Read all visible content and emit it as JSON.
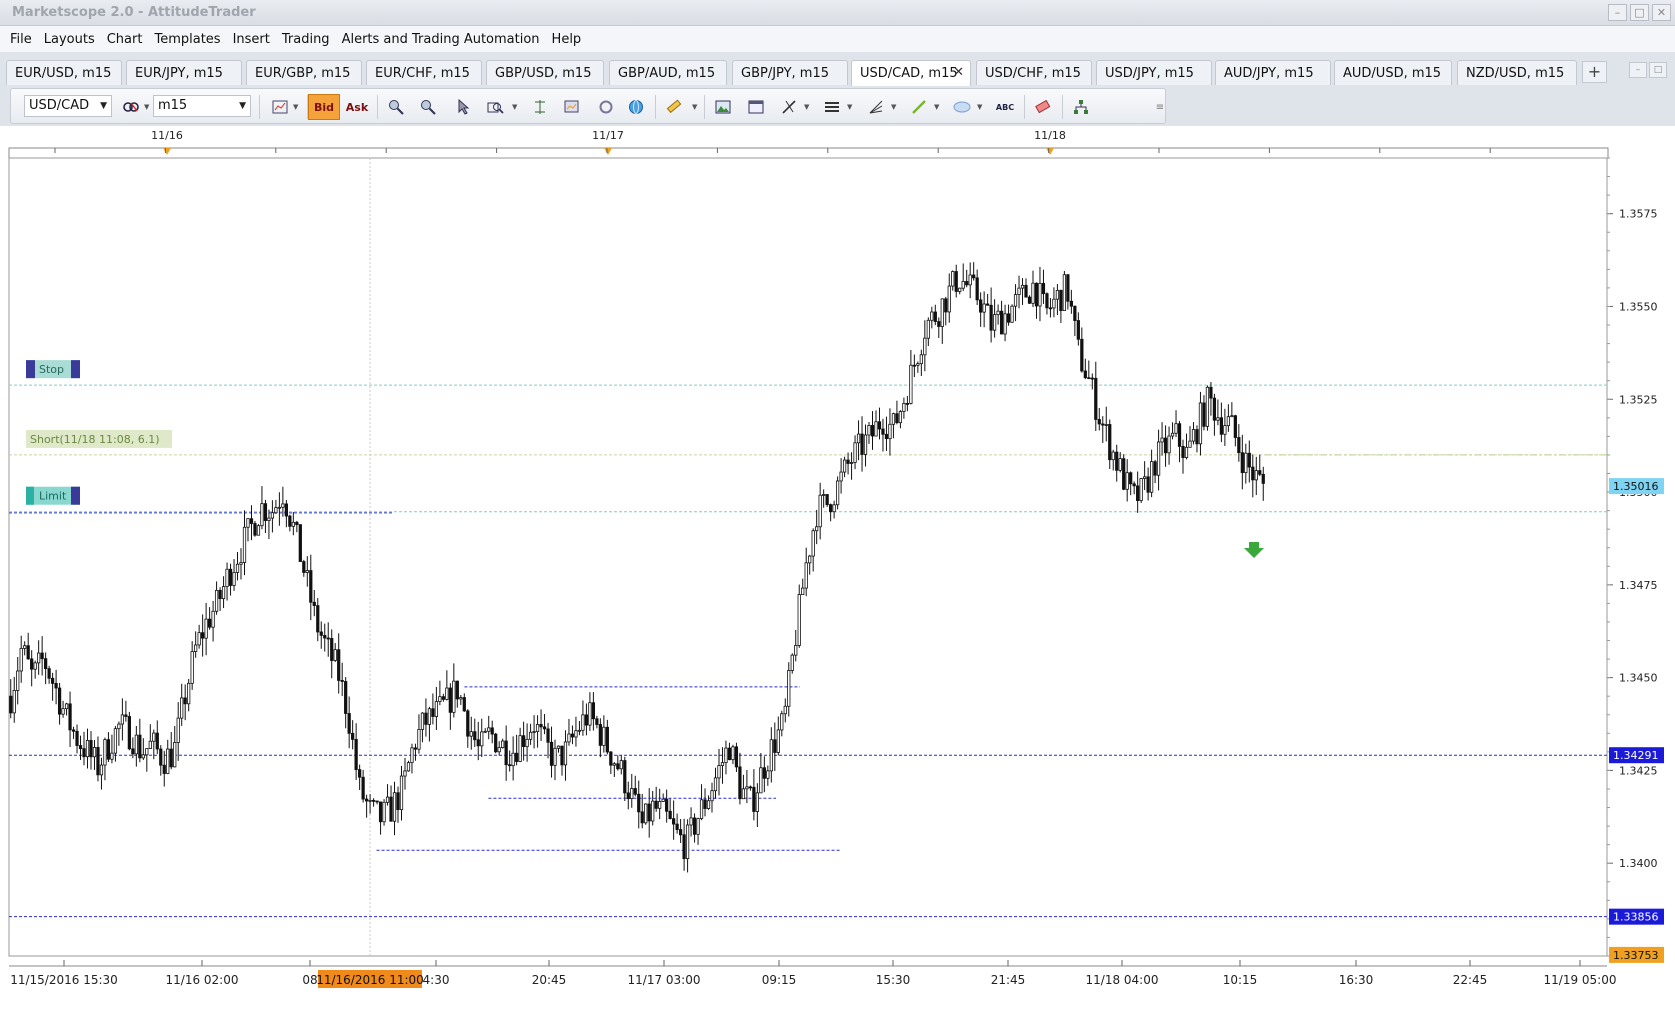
{
  "window": {
    "title": "Marketscope 2.0 - AttitudeTrader"
  },
  "menu": [
    "File",
    "Layouts",
    "Chart",
    "Templates",
    "Insert",
    "Trading",
    "Alerts and Trading Automation",
    "Help"
  ],
  "tabs": [
    {
      "label": "EUR/USD, m15"
    },
    {
      "label": "EUR/JPY, m15"
    },
    {
      "label": "EUR/GBP, m15"
    },
    {
      "label": "EUR/CHF, m15"
    },
    {
      "label": "GBP/USD, m15"
    },
    {
      "label": "GBP/AUD, m15"
    },
    {
      "label": "GBP/JPY, m15"
    },
    {
      "label": "USD/CAD, m15",
      "active": true
    },
    {
      "label": "USD/CHF, m15"
    },
    {
      "label": "USD/JPY, m15"
    },
    {
      "label": "AUD/JPY, m15"
    },
    {
      "label": "AUD/USD, m15"
    },
    {
      "label": "NZD/USD, m15"
    }
  ],
  "toolbar": {
    "instrument": "USD/CAD",
    "timeframe": "m15",
    "bid_label": "Bid",
    "ask_label": "Ask",
    "text_tool_label": "ABC"
  },
  "chart_data": {
    "type": "candlestick",
    "instrument": "USD/CAD",
    "timeframe": "m15",
    "top_dates": [
      "11/16",
      "11/17",
      "11/18"
    ],
    "x_ticks": [
      "11/15/2016 15:30",
      "11/16 02:00",
      "08",
      "4:30",
      "20:45",
      "11/17 03:00",
      "09:15",
      "15:30",
      "21:45",
      "11/18 04:00",
      "10:15",
      "16:30",
      "22:45",
      "11/19 05:00"
    ],
    "cursor_time_label": "11/16/2016 11:00",
    "y_ticks": [
      "1.3575",
      "1.3550",
      "1.3525",
      "1.3500",
      "1.3475",
      "1.3450",
      "1.3425",
      "1.3400"
    ],
    "ylim": [
      1.3375,
      1.359
    ],
    "current_price": "1.35016",
    "price_tags": [
      {
        "value": "1.34291",
        "level": 1.34291,
        "color": "#1a1ad8"
      },
      {
        "value": "1.33856",
        "level": 1.33856,
        "color": "#1a1ad8"
      },
      {
        "value": "1.33753",
        "level": 1.33753,
        "color": "#f0a020"
      }
    ],
    "orders": {
      "stop_label": "Stop",
      "stop_level": 1.35288,
      "entry_label": "Short(11/18 11:08, 6.1)",
      "entry_level": 1.351,
      "limit_label": "Limit",
      "limit_level": 1.34947
    },
    "horizontal_lines": [
      {
        "level": 1.34944,
        "from": 0.0,
        "to": 0.24
      },
      {
        "level": 1.34475,
        "from": 0.285,
        "to": 0.495
      },
      {
        "level": 1.34175,
        "from": 0.3,
        "to": 0.48
      },
      {
        "level": 1.34035,
        "from": 0.23,
        "to": 0.52
      }
    ],
    "close_path": [
      1.3445,
      1.3458,
      1.345,
      1.3455,
      1.3448,
      1.344,
      1.3434,
      1.343,
      1.3426,
      1.3432,
      1.3437,
      1.3435,
      1.343,
      1.3432,
      1.3428,
      1.343,
      1.3445,
      1.3458,
      1.3465,
      1.347,
      1.3478,
      1.3484,
      1.349,
      1.3496,
      1.3495,
      1.35,
      1.349,
      1.3478,
      1.3465,
      1.3458,
      1.3452,
      1.344,
      1.342,
      1.3414,
      1.3412,
      1.3415,
      1.342,
      1.3432,
      1.3438,
      1.344,
      1.3443,
      1.3447,
      1.3438,
      1.343,
      1.3435,
      1.3432,
      1.343,
      1.3434,
      1.3438,
      1.3432,
      1.3428,
      1.343,
      1.3436,
      1.344,
      1.3436,
      1.343,
      1.3425,
      1.3418,
      1.341,
      1.3415,
      1.3413,
      1.3408,
      1.3405,
      1.3412,
      1.3418,
      1.3425,
      1.3432,
      1.342,
      1.3416,
      1.3425,
      1.3432,
      1.3438,
      1.346,
      1.348,
      1.3495,
      1.3497,
      1.3502,
      1.3508,
      1.3512,
      1.3515,
      1.352,
      1.3517,
      1.3525,
      1.3535,
      1.3545,
      1.3548,
      1.3553,
      1.3558,
      1.3555,
      1.3552,
      1.3545,
      1.3547,
      1.355,
      1.3553,
      1.3556,
      1.3548,
      1.3552,
      1.3555,
      1.3538,
      1.353,
      1.352,
      1.3512,
      1.3505,
      1.3498,
      1.35,
      1.3508,
      1.3512,
      1.3515,
      1.351,
      1.3518,
      1.3525,
      1.352,
      1.3518,
      1.351,
      1.3505,
      1.3502
    ]
  }
}
